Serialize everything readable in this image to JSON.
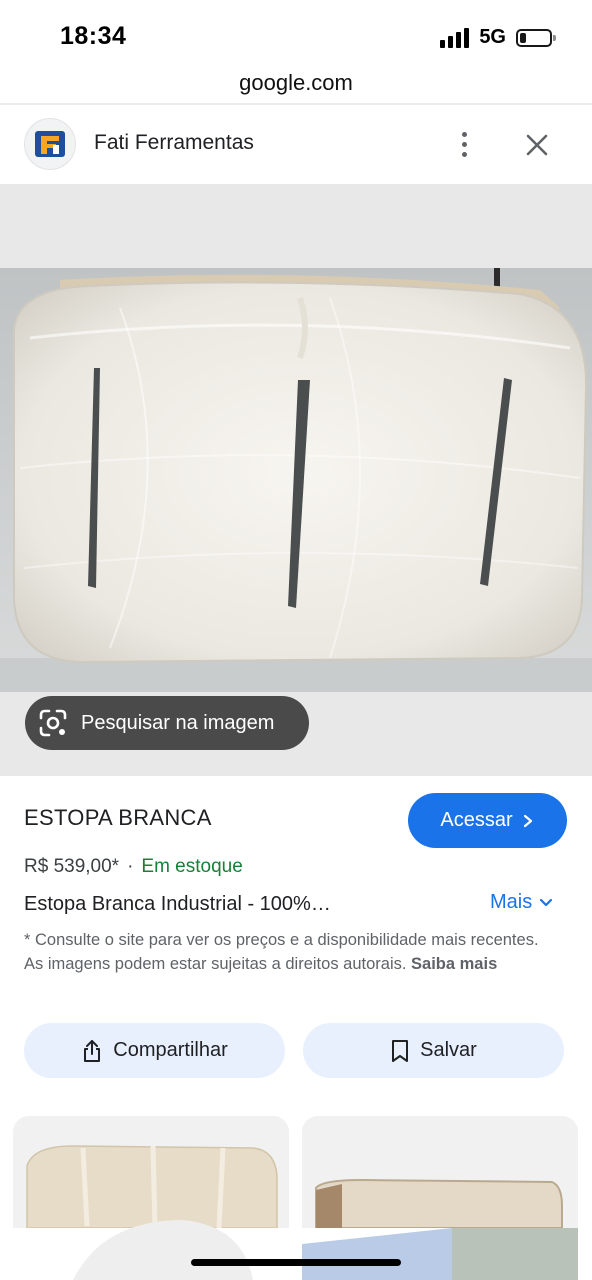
{
  "status_bar": {
    "time": "18:34",
    "network": "5G",
    "battery_level": 0.2
  },
  "browser": {
    "url": "google.com"
  },
  "source": {
    "name": "Fati Ferramentas",
    "logo_letter": "F",
    "menu_icon": "more-vert-icon",
    "close_icon": "close-icon"
  },
  "image_panel": {
    "lens_label": "Pesquisar na imagem",
    "lens_icon": "lens-search-icon"
  },
  "product": {
    "title": "ESTOPA BRANCA",
    "access_label": "Acessar",
    "price": "R$ 539,00*",
    "separator": "·",
    "stock_status": "Em estoque",
    "description": "Estopa Branca Industrial - 100%…",
    "more_label": "Mais",
    "disclaimer": "* Consulte o site para ver os preços e a disponibilidade mais recentes. As imagens podem estar sujeitas a direitos autorais.",
    "learn_more": "Saiba mais"
  },
  "actions": {
    "share_label": "Compartilhar",
    "save_label": "Salvar"
  },
  "colors": {
    "accent": "#1a73e8",
    "stock_green": "#188038",
    "pill_bg": "#e8f0fe"
  }
}
